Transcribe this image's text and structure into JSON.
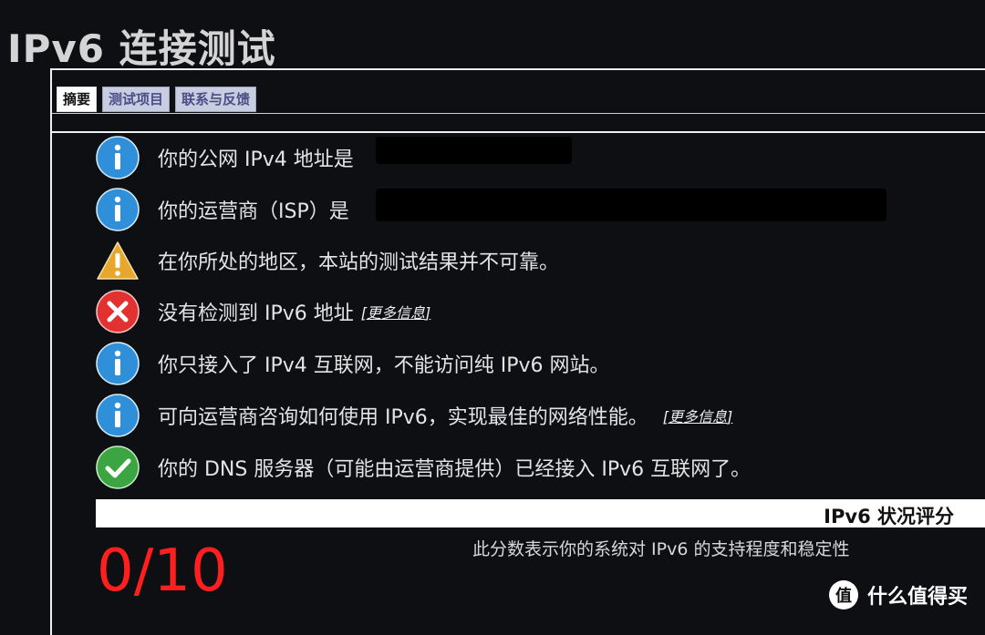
{
  "page": {
    "title": "IPv6 连接测试"
  },
  "tabs": [
    {
      "label": "摘要",
      "active": true
    },
    {
      "label": "测试项目",
      "active": false
    },
    {
      "label": "联系与反馈",
      "active": false
    }
  ],
  "results": [
    {
      "icon": "info-icon",
      "text": "你的公网 IPv4 地址是"
    },
    {
      "icon": "info-icon",
      "text": "你的运营商（ISP）是"
    },
    {
      "icon": "warning-icon",
      "text": "在你所处的地区，本站的测试结果并不可靠。"
    },
    {
      "icon": "error-icon",
      "text": "没有检测到 IPv6 地址",
      "link": "更多信息"
    },
    {
      "icon": "info-icon",
      "text": "你只接入了 IPv4 互联网，不能访问纯 IPv6 网站。"
    },
    {
      "icon": "info-icon",
      "text": "可向运营商咨询如何使用 IPv6，实现最佳的网络性能。",
      "link": "更多信息"
    },
    {
      "icon": "success-icon",
      "text": "你的 DNS 服务器（可能由运营商提供）已经接入 IPv6 互联网了。"
    }
  ],
  "score": {
    "title": "IPv6 状况评分",
    "value": "0/10",
    "description": "此分数表示你的系统对 IPv6 的支持程度和稳定性"
  },
  "watermark": {
    "text": "什么值得买",
    "logo_glyph": "值"
  },
  "colors": {
    "info": "#2f8fd8",
    "warning": "#e6a72a",
    "error": "#e23131",
    "success": "#3aa541",
    "score": "#ff1f1f"
  }
}
